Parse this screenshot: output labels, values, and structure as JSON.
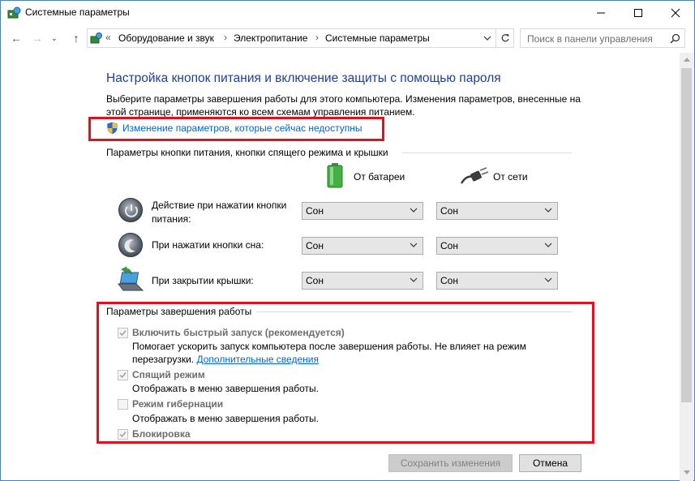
{
  "window": {
    "title": "Системные параметры",
    "minimize": "—",
    "maximize": "☐",
    "close": "✕"
  },
  "nav": {
    "back": "←",
    "forward": "→",
    "recent": "⌄",
    "up": "↑"
  },
  "address": {
    "overflow": "«",
    "crumbs": [
      "Оборудование и звук",
      "Электропитание",
      "Системные параметры"
    ],
    "separator": "›"
  },
  "search": {
    "placeholder": "Поиск в панели управления"
  },
  "page": {
    "heading": "Настройка кнопок питания и включение защиты с помощью пароля",
    "description": "Выберите параметры завершения работы для этого компьютера. Изменения параметров, внесенные на этой странице, применяются ко всем схемам управления питанием.",
    "change_link": "Изменение параметров, которые сейчас недоступны"
  },
  "power_buttons": {
    "section_title": "Параметры кнопки питания, кнопки спящего режима и крышки",
    "col_battery": "От батареи",
    "col_ac": "От сети",
    "rows": [
      {
        "label": "Действие при нажатии кнопки питания:",
        "battery": "Сон",
        "ac": "Сон",
        "icon": "power-button-icon"
      },
      {
        "label": "При нажатии кнопки сна:",
        "battery": "Сон",
        "ac": "Сон",
        "icon": "sleep-button-icon"
      },
      {
        "label": "При закрытии крышки:",
        "battery": "Сон",
        "ac": "Сон",
        "icon": "laptop-lid-icon"
      }
    ]
  },
  "shutdown": {
    "section_title": "Параметры завершения работы",
    "items": [
      {
        "label": "Включить быстрый запуск (рекомендуется)",
        "checked": true,
        "desc": "Помогает ускорить запуск компьютера после завершения работы. Не влияет на режим перезагрузки.",
        "more_link": "Дополнительные сведения"
      },
      {
        "label": "Спящий режим",
        "checked": true,
        "desc": "Отображать в меню завершения работы."
      },
      {
        "label": "Режим гибернации",
        "checked": false,
        "desc": "Отображать в меню завершения работы."
      },
      {
        "label": "Блокировка",
        "checked": true
      }
    ]
  },
  "buttons": {
    "save": "Сохранить изменения",
    "cancel": "Отмена"
  },
  "colors": {
    "heading": "#1e3f9a",
    "link": "#0066cc",
    "highlight": "#e0101c"
  }
}
